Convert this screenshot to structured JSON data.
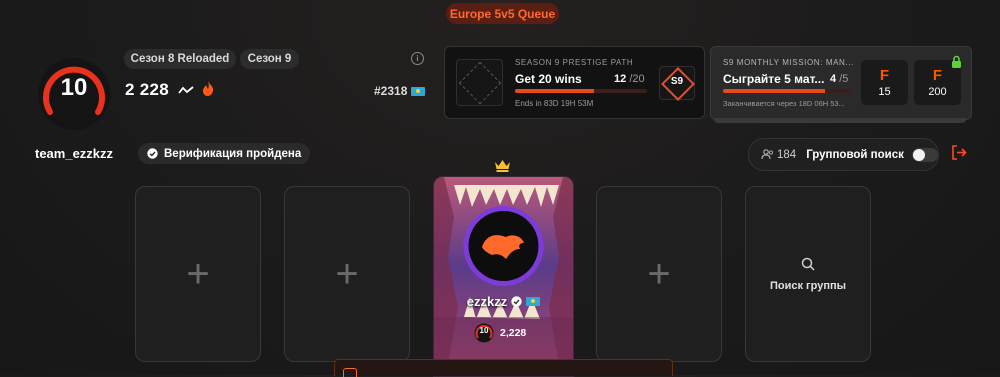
{
  "queue": {
    "label": "Europe 5v5 Queue"
  },
  "profile": {
    "level": "10",
    "season_chips": [
      "Сезон 8 Reloaded",
      "Сезон 9"
    ],
    "elo": "2 228",
    "rank": "#2318",
    "username": "team_ezzkzz",
    "verification_label": "Верификация пройдена"
  },
  "prestige": {
    "header": "SEASON 9 PRESTIGE PATH",
    "title": "Get 20 wins",
    "progress_current": "12",
    "progress_total": "/20",
    "progress_fraction": 0.6,
    "ends": "Ends in 83D 19H 53M",
    "badge": "S9"
  },
  "mission": {
    "header": "S9 MONTHLY MISSION: MAN...",
    "title": "Сыграйте 5 мат...",
    "progress_current": "4",
    "progress_total": "/5",
    "progress_fraction": 0.8,
    "ends": "Заканчивается через 18D 06H 53...",
    "rewards": [
      {
        "icon": "F",
        "value": "15"
      },
      {
        "icon": "F",
        "value": "200"
      }
    ]
  },
  "group": {
    "count": "184",
    "label": "Групповой поиск",
    "toggle_on": false
  },
  "party": {
    "player_name": "ezzkzz",
    "player_level": "10",
    "player_elo": "2,228",
    "search_label": "Поиск группы"
  },
  "colors": {
    "accent": "#ff5500",
    "brand_bg": "#1b1b1b"
  },
  "icons": [
    "info-icon",
    "trend-icon",
    "fire-icon",
    "flag-kz-icon",
    "lock-icon",
    "verified-icon",
    "users-icon",
    "logout-icon",
    "plus-icon",
    "search-icon",
    "crown-icon"
  ]
}
